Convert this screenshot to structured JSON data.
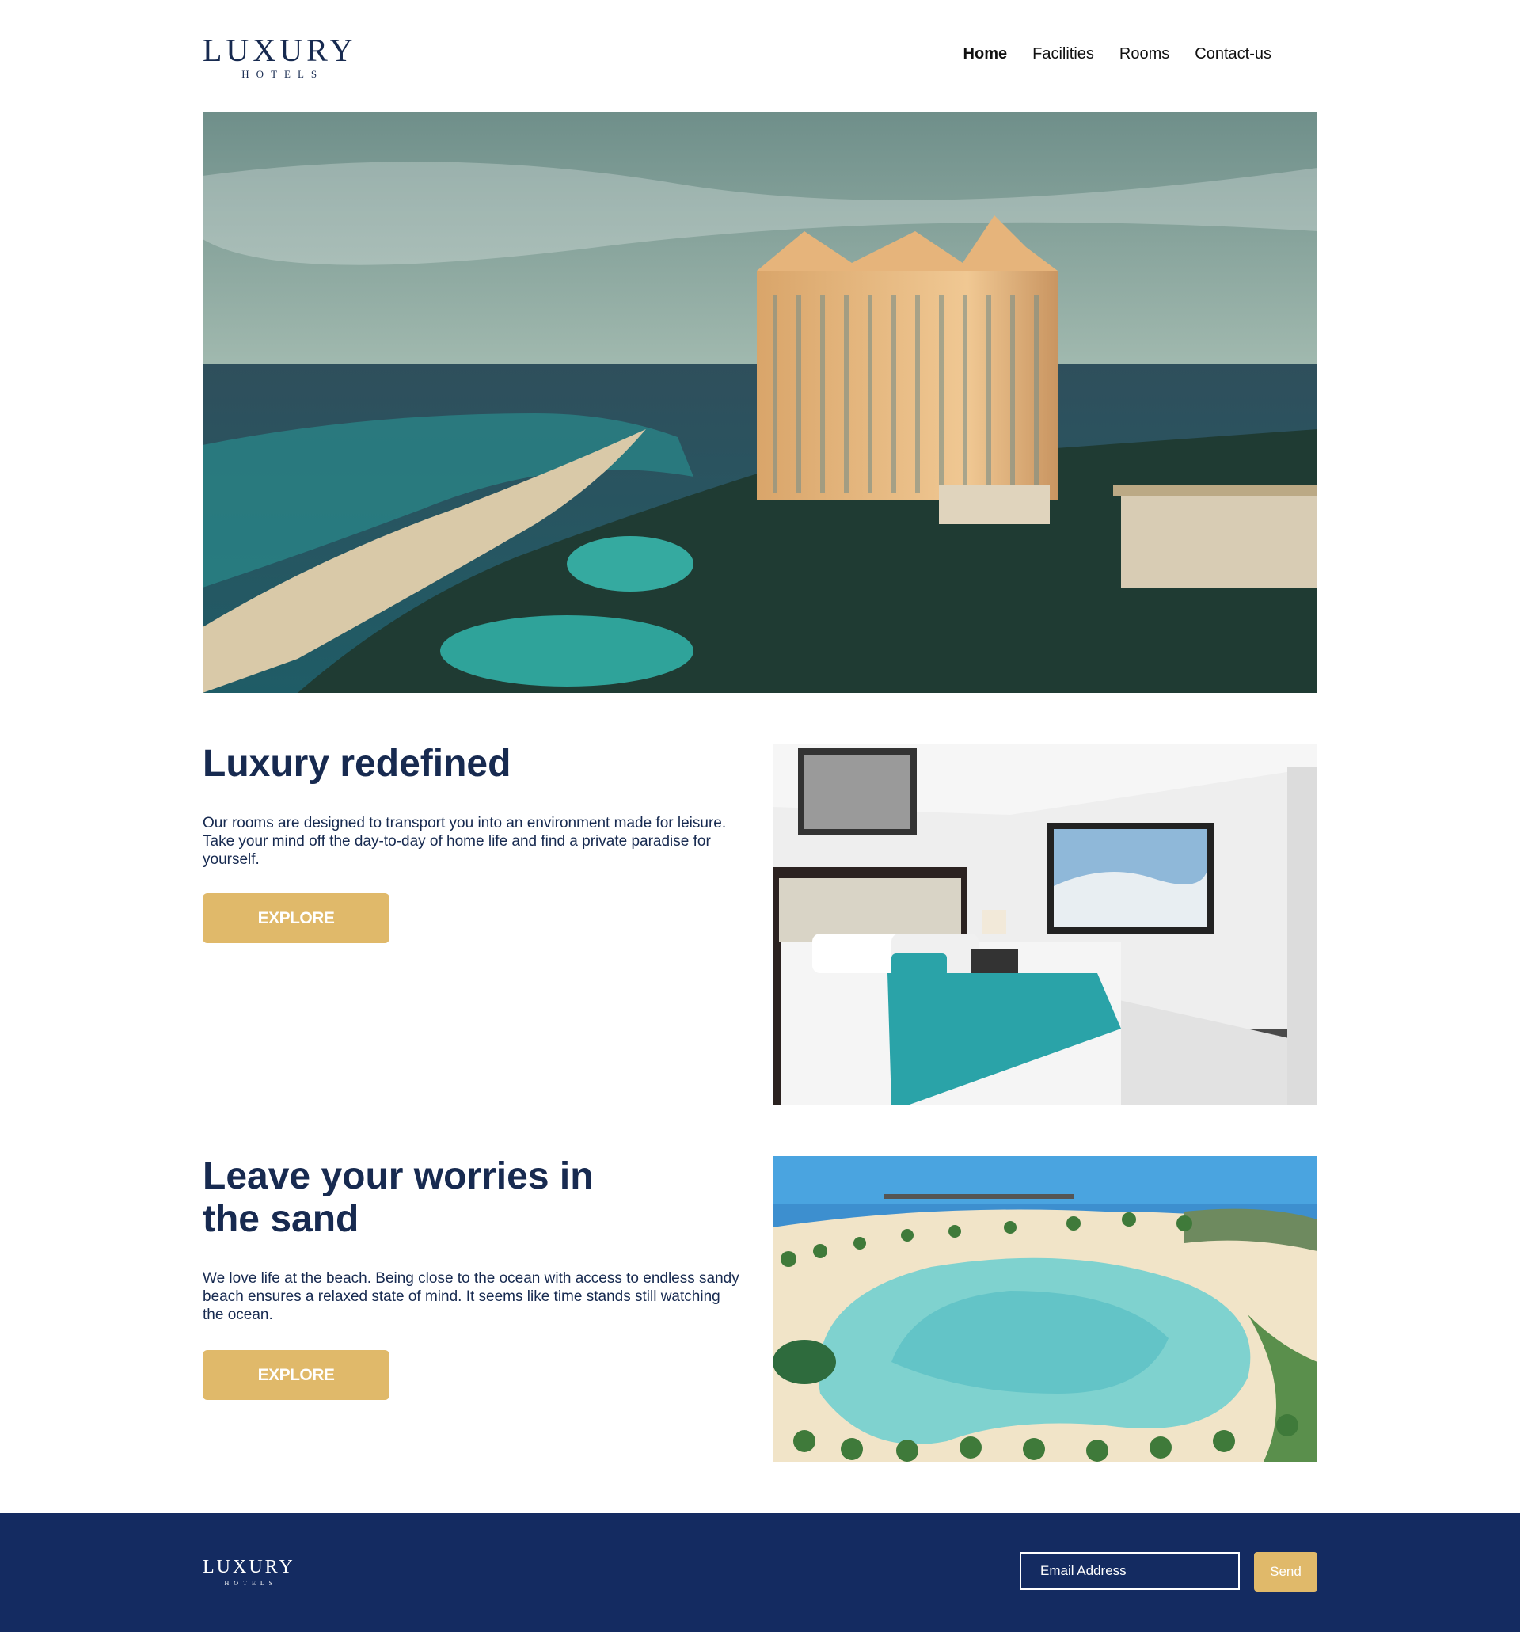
{
  "header": {
    "logo": {
      "brand": "LUXURY",
      "sub": "HOTELS"
    },
    "nav": [
      {
        "label": "Home",
        "active": true
      },
      {
        "label": "Facilities",
        "active": false
      },
      {
        "label": "Rooms",
        "active": false
      },
      {
        "label": "Contact-us",
        "active": false
      }
    ]
  },
  "sections": [
    {
      "title": "Luxury redefined",
      "body": "Our rooms are designed to transport you into an environment made for leisure. Take your mind off the day-to-day of home life and find a private paradise for yourself.",
      "button": "EXPLORE"
    },
    {
      "title_line1": "Leave your worries in",
      "title_line2": "the sand",
      "body": "We love life at the beach. Being close to the ocean with access to endless sandy beach ensures a relaxed state of mind. It  seems like time stands still watching the  ocean.",
      "button": "EXPLORE"
    }
  ],
  "footer": {
    "logo": {
      "brand": "LUXURY",
      "sub": "HOTELS"
    },
    "email_placeholder": "Email Address",
    "send_label": "Send"
  },
  "colors": {
    "navy": "#172a50",
    "footer_bg": "#142b61",
    "gold": "#e0b96a"
  }
}
